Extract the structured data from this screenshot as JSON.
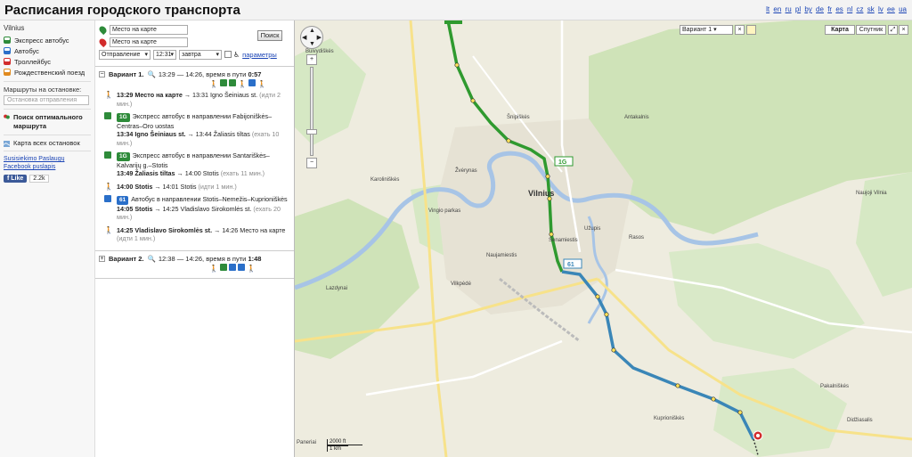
{
  "header": {
    "title": "Расписания городского транспорта",
    "languages": [
      "lt",
      "en",
      "ru",
      "pl",
      "by",
      "de",
      "fr",
      "es",
      "nl",
      "cz",
      "sk",
      "lv",
      "ee",
      "ua"
    ]
  },
  "sidebar": {
    "city": "Vilnius",
    "modes": [
      {
        "label": "Экспресс автобус",
        "color": "#2e8b3a"
      },
      {
        "label": "Автобус",
        "color": "#2a6fc9"
      },
      {
        "label": "Троллейбус",
        "color": "#d22c2c"
      },
      {
        "label": "Рождественский поезд",
        "color": "#e08a1e"
      }
    ],
    "stop_routes_label": "Маршруты на остановке:",
    "stop_input_placeholder": "Остановка отправления",
    "optimal_route_label": "Поиск оптимального маршрута",
    "all_stops_label": "Карта всех остановок",
    "links": [
      "Susisiekimo Paslaugų",
      "Facebook puslapis"
    ],
    "like_label": "Like",
    "like_count": "2.2k"
  },
  "search": {
    "from_value": "Место на карте",
    "to_value": "Место на карте",
    "search_button": "Поиск",
    "departure_option": "Отправление",
    "time_value": "12:31",
    "day_option": "завтра",
    "params_link": "параметры"
  },
  "variants": [
    {
      "name": "Вариант 1.",
      "summary_prefix": "13:29 — 14:26, время в пути",
      "duration": "0:57",
      "expanded": true,
      "steps": [
        {
          "type": "walk",
          "time_from": "13:29",
          "from": "Место на карте",
          "arrow": "→ 13:31 Igno Šeiniaus st.",
          "note": "(идти 2 мин.)"
        },
        {
          "type": "express",
          "route": "1G",
          "color": "#2e8b3a",
          "direction": "Экспресс автобус в направлении Fabijoniškės–Centras–Oro uostas",
          "ride": "13:34 Igno Šeiniaus st.",
          "arrow": "→ 13:44 Žaliasis tiltas",
          "note": "(ехать 10 мин.)"
        },
        {
          "type": "express",
          "route": "1G",
          "color": "#2e8b3a",
          "direction": "Экспресс автобус в направлении Santariškės–Kalvarijų g.–Stotis",
          "ride": "13:49 Žaliasis tiltas",
          "arrow": "→ 14:00 Stotis",
          "note": "(ехать 11 мин.)"
        },
        {
          "type": "walk",
          "time_from": "14:00",
          "from": "Stotis",
          "arrow": "→ 14:01 Stotis",
          "note": "(идти 1 мин.)"
        },
        {
          "type": "bus",
          "route": "61",
          "color": "#2a6fc9",
          "direction": "Автобус в направлении Stotis–Nemežis–Kuprioniškės",
          "ride": "14:05 Stotis",
          "arrow": "→ 14:25 Vladislavo Sirokomlės st.",
          "note": "(ехать 20 мин.)"
        },
        {
          "type": "walk",
          "time_from": "14:25",
          "from": "Vladislavo Sirokomlės st.",
          "arrow": "→ 14:26 Место на карте",
          "note": "(идти 1 мин.)"
        }
      ]
    },
    {
      "name": "Вариант 2.",
      "summary_prefix": "12:38 — 14:26, время в пути",
      "duration": "1:48",
      "expanded": false
    }
  ],
  "map": {
    "type_label": "Вариант 1",
    "map_button": "Карта",
    "satellite_button": "Спутник",
    "scale_ft": "2000 ft",
    "scale_km": "1 km",
    "route_labels": [
      "1G",
      "61"
    ],
    "places": [
      "Vilnius",
      "Šnipiškės",
      "Žvėrynas",
      "Karoliniškės",
      "Vingio parkas",
      "Naujamiestis",
      "Senamiestis",
      "Užupis",
      "Rasos",
      "Vilkpėdė",
      "Lazdynai",
      "Paneriai",
      "Kuprioniškės",
      "Pakalniškės",
      "Didžiasalis",
      "Naujoji Vilnia",
      "Buivydiškės",
      "Antakalnis"
    ]
  }
}
